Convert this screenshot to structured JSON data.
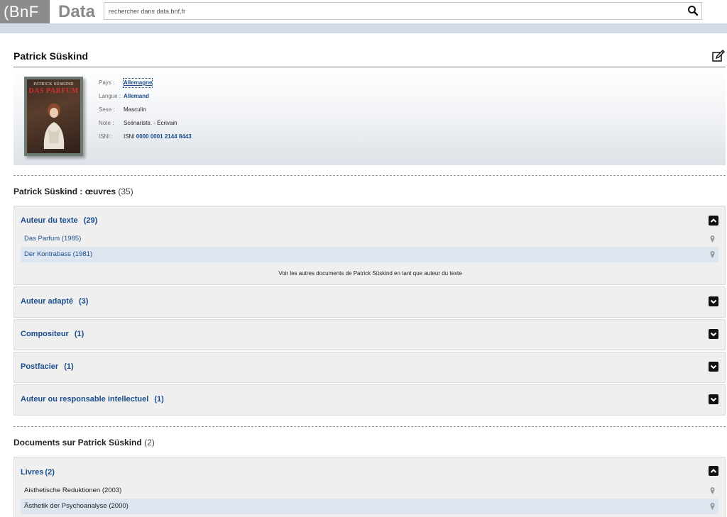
{
  "header": {
    "logo_bnf": "BnF",
    "logo_data": "Data",
    "search": {
      "placeholder": "rechercher dans data.bnf.fr",
      "value": ""
    }
  },
  "author": {
    "name": "Patrick Süskind",
    "cover": {
      "author": "PATRICK SÜSKIND",
      "title": "DAS PARFUM"
    },
    "info": {
      "pays": {
        "label": "Pays :",
        "value": "Allemagne"
      },
      "langue": {
        "label": "Langue :",
        "value": "Allemand"
      },
      "sexe": {
        "label": "Sexe :",
        "value": "Masculin"
      },
      "note": {
        "label": "Note :",
        "value": "Scénariste. - Écrivain"
      },
      "isni": {
        "label": "ISNI :",
        "prefix": "ISNI",
        "value": "0000 0001 2144 8443"
      }
    }
  },
  "works": {
    "title": "Patrick Süskind : œuvres",
    "count": "(35)",
    "groups": [
      {
        "label": "Auteur du texte",
        "count": "(29)",
        "expanded": true,
        "items": [
          "Das Parfum (1985)",
          "Der Kontrabass (1981)"
        ],
        "more": "Voir les autres documents de Patrick Süskind en tant que auteur du texte"
      },
      {
        "label": "Auteur adapté",
        "count": "(3)",
        "expanded": false
      },
      {
        "label": "Compositeur",
        "count": "(1)",
        "expanded": false
      },
      {
        "label": "Postfacier",
        "count": "(1)",
        "expanded": false
      },
      {
        "label": "Auteur ou responsable intellectuel",
        "count": "(1)",
        "expanded": false
      }
    ]
  },
  "documents": {
    "title": "Documents sur Patrick Süskind",
    "count": "(2)",
    "groups": [
      {
        "label": "Livres",
        "count": "(2)",
        "expanded": true,
        "items": [
          "Aisthetische Reduktionen (2003)",
          "Ästhetik der Psychoanalyse (2000)"
        ]
      }
    ]
  },
  "colors": {
    "link": "#1b4d8c",
    "row_alt": "#dde6f0",
    "panel_bg": "#efefef",
    "logo_bg": "#8c8c8c"
  }
}
